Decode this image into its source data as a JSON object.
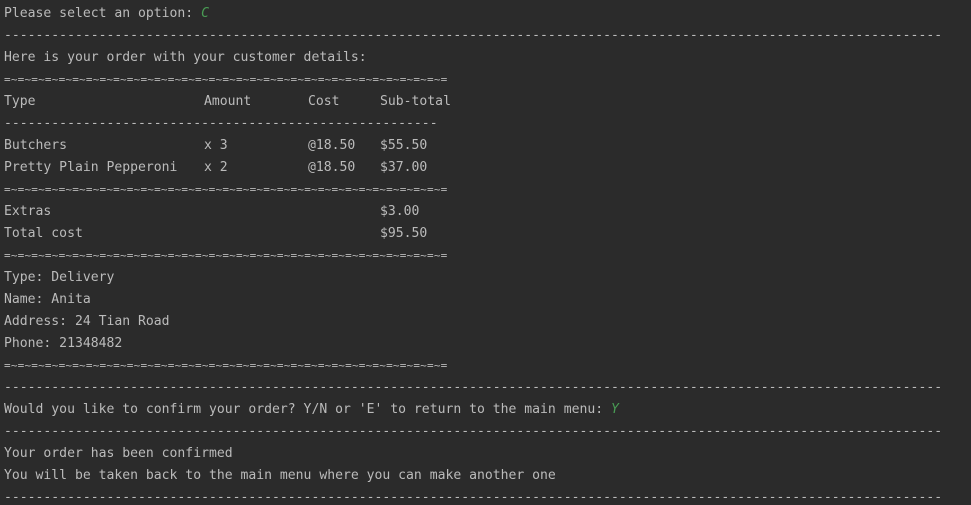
{
  "prompt": {
    "text": "Please select an option: ",
    "input": "C"
  },
  "separator_long": "-----------------------------------------------------------------------------------------------------------------------",
  "separator_short_dash": "-------------------------------------------------------",
  "separator_eq": "=~=~=~=~=~=~=~=~=~=~=~=~=~=~=~=~=~=~=~=~=~=~=~=~=~=~=~=~=~=~=~=~=",
  "order_heading": "Here is your order with your customer details:",
  "table": {
    "headers": [
      "Type",
      "Amount",
      "Cost",
      "Sub-total"
    ],
    "rows": [
      [
        "Butchers",
        "x 3",
        "@18.50",
        "$55.50"
      ],
      [
        "Pretty Plain Pepperoni",
        "x 2",
        "@18.50",
        "$37.00"
      ]
    ]
  },
  "extras": {
    "label": "Extras",
    "value": "$3.00"
  },
  "total": {
    "label": "Total cost",
    "value": "$95.50"
  },
  "customer": {
    "type": "Type: Delivery",
    "name": "Name: Anita",
    "address": "Address: 24 Tian Road",
    "phone": "Phone: 21348482"
  },
  "confirm_prompt": {
    "text": "Would you like to confirm your order? Y/N or 'E' to return to the main menu: ",
    "input": "Y"
  },
  "confirmation": {
    "line1": "Your order has been confirmed",
    "line2": "You will be taken back to the main menu where you can make another one"
  }
}
